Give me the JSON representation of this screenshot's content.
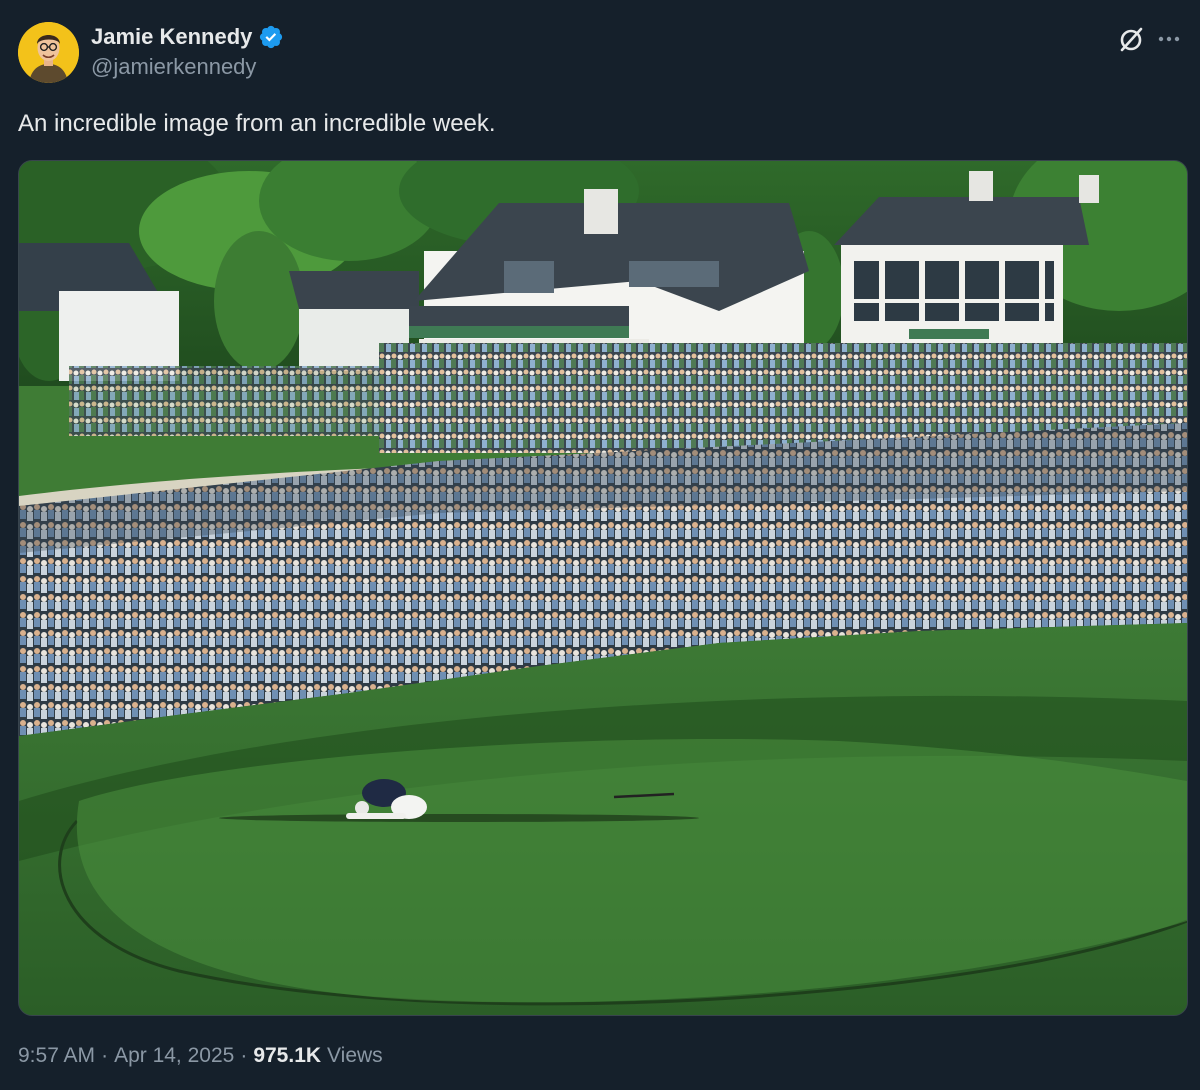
{
  "author": {
    "display_name": "Jamie Kennedy",
    "handle": "@jamierkennedy",
    "verified": true
  },
  "post": {
    "text": "An incredible image from an incredible week.",
    "time": "9:57 AM",
    "date": "Apr 14, 2025",
    "separator": "·",
    "views_count": "975.1K",
    "views_label": "Views"
  },
  "icons": {
    "verified": "verified-badge-icon",
    "grok": "grok-icon",
    "more": "more-options-icon"
  },
  "colors": {
    "background": "#15202b",
    "text_primary": "#e7e9ea",
    "text_secondary": "#8b98a5",
    "verified_blue": "#1d9bf0",
    "avatar_yellow": "#f3c21a"
  }
}
